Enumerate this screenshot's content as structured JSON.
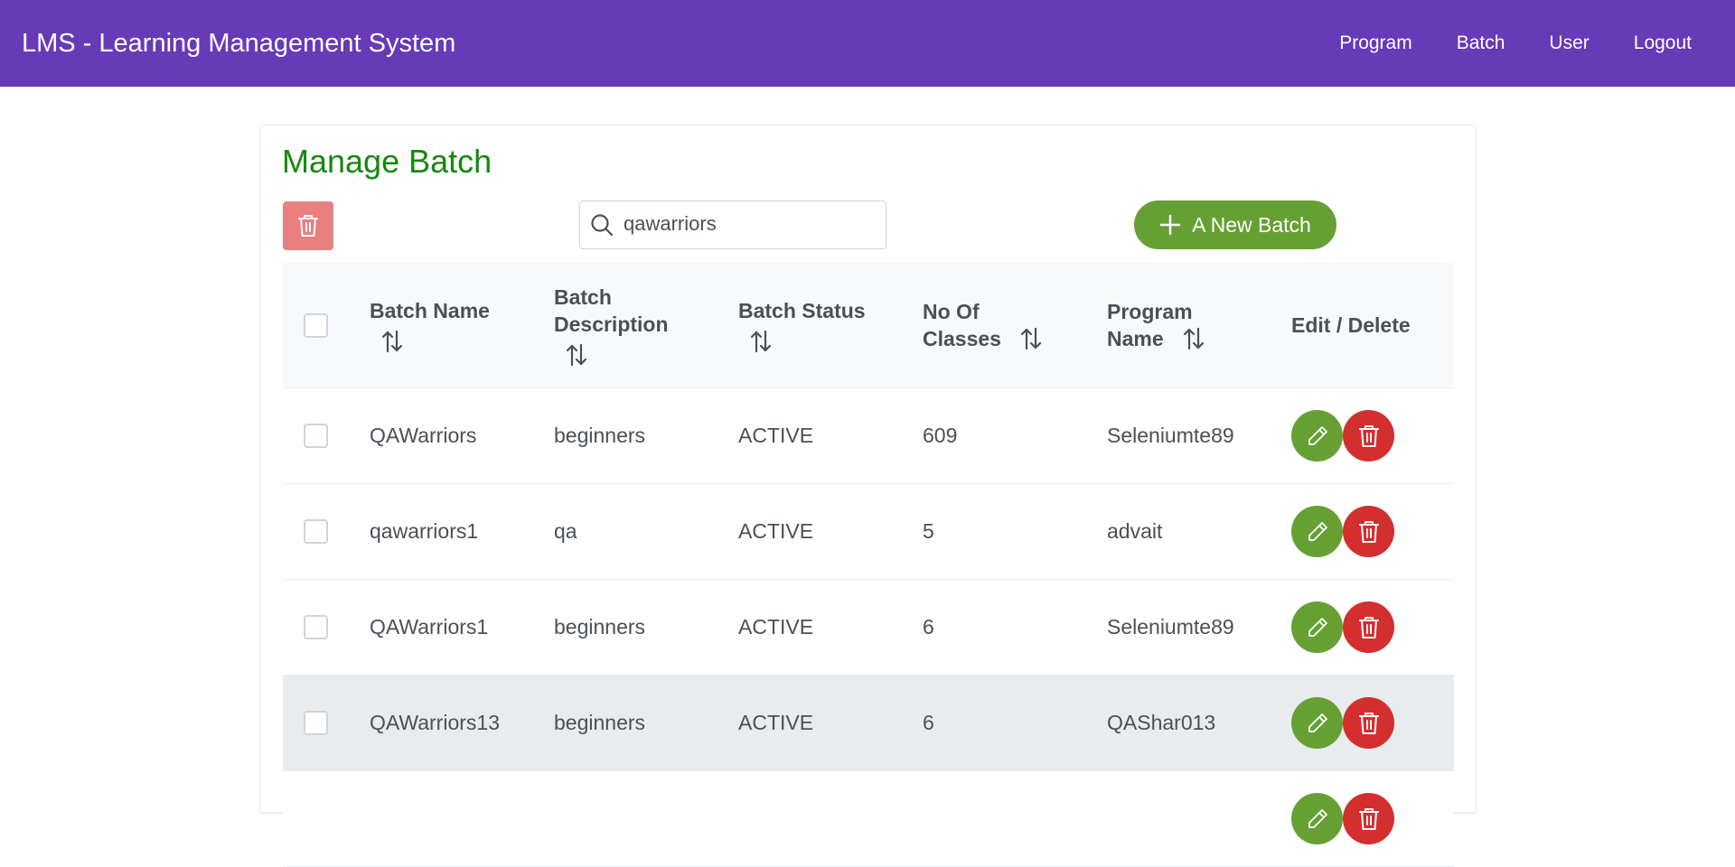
{
  "app": {
    "title": "LMS - Learning Management System"
  },
  "nav": {
    "items": [
      "Program",
      "Batch",
      "User",
      "Logout"
    ]
  },
  "page": {
    "title": "Manage Batch"
  },
  "toolbar": {
    "search_value": "qawarriors",
    "new_batch_label": "A New Batch"
  },
  "table": {
    "headers": {
      "batch_name": "Batch Name",
      "batch_description_l1": "Batch",
      "batch_description_l2": "Description",
      "batch_status": "Batch Status",
      "no_of_classes_l1": "No Of",
      "no_of_classes_l2": "Classes",
      "program_name_l1": "Program",
      "program_name_l2": "Name",
      "edit_delete": "Edit / Delete"
    },
    "rows": [
      {
        "name": "QAWarriors",
        "description": "beginners",
        "status": "ACTIVE",
        "classes": "609",
        "program": "Seleniumte89"
      },
      {
        "name": "qawarriors1",
        "description": "qa",
        "status": "ACTIVE",
        "classes": "5",
        "program": "advait"
      },
      {
        "name": "QAWarriors1",
        "description": "beginners",
        "status": "ACTIVE",
        "classes": "6",
        "program": "Seleniumte89"
      },
      {
        "name": "QAWarriors13",
        "description": "beginners",
        "status": "ACTIVE",
        "classes": "6",
        "program": "QAShar013"
      }
    ]
  },
  "colors": {
    "header_bg": "#673ab7",
    "title_green": "#15880f",
    "edit_green": "#66a033",
    "delete_red": "#d32f2f",
    "bulk_delete_pink": "#e88080"
  },
  "icons": {
    "bulk_delete": "trash-icon",
    "search": "search-icon",
    "new_batch": "plus-icon",
    "sort": "sort-arrows-icon",
    "edit": "pencil-icon",
    "delete": "trash-icon"
  }
}
